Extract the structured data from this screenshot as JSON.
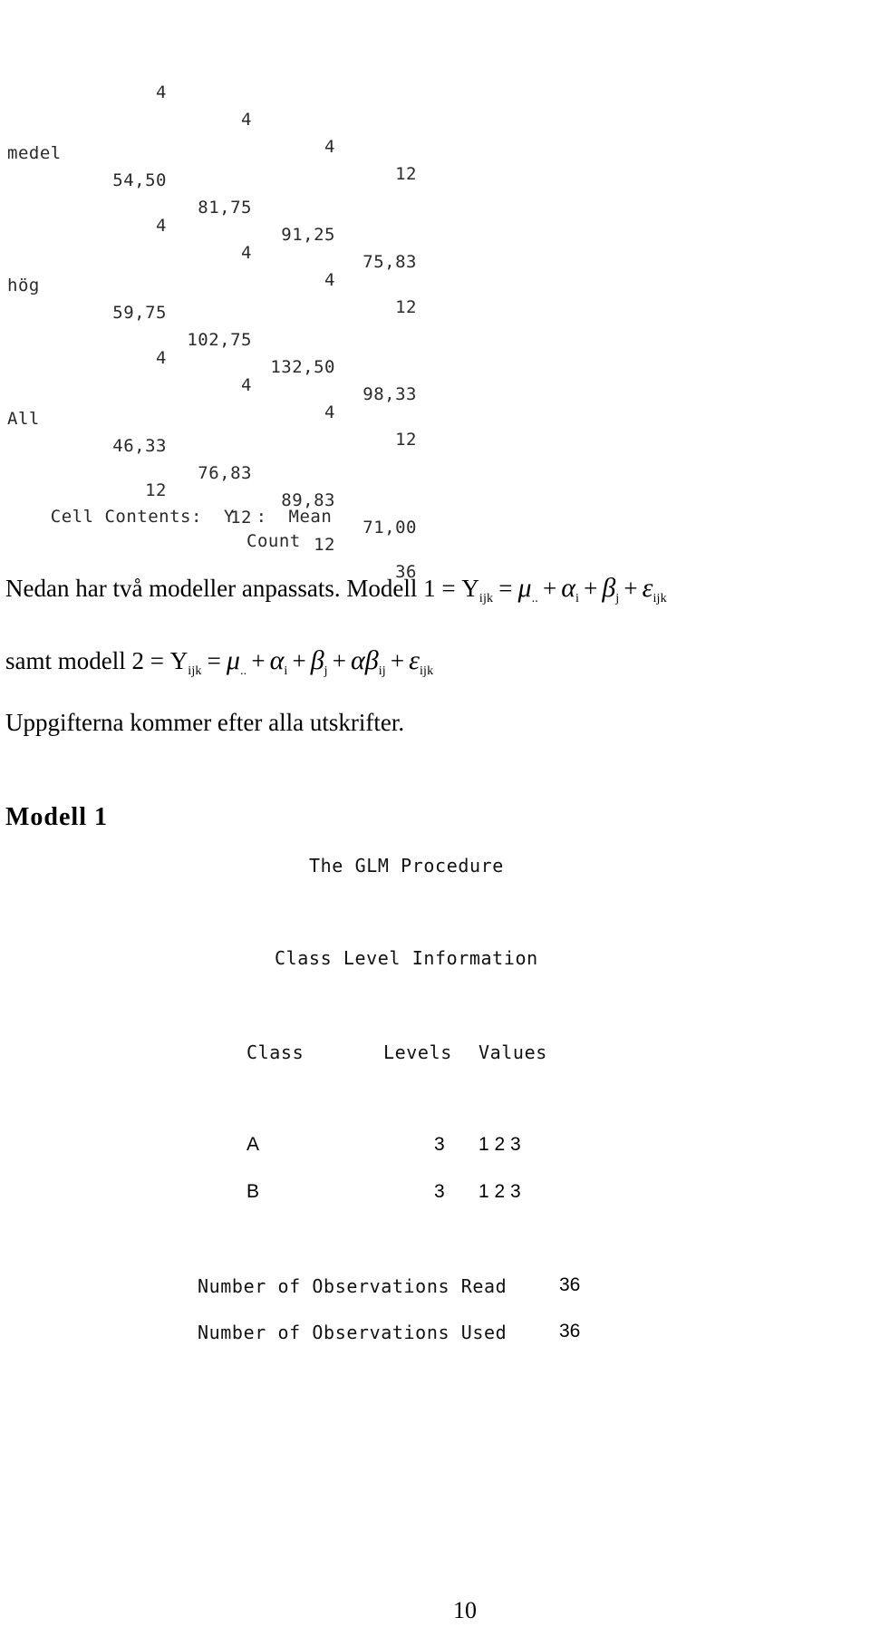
{
  "crosstab": {
    "rows": [
      {
        "label": "",
        "kind": "count",
        "cells": [
          "4",
          "4",
          "4",
          "12"
        ]
      },
      {
        "label": "medel",
        "kind": "mean",
        "cells": [
          "54,50",
          "81,75",
          "91,25",
          "75,83"
        ]
      },
      {
        "label": "",
        "kind": "count",
        "cells": [
          "4",
          "4",
          "4",
          "12"
        ]
      },
      {
        "label": "hög",
        "kind": "mean",
        "cells": [
          "59,75",
          "102,75",
          "132,50",
          "98,33"
        ]
      },
      {
        "label": "",
        "kind": "count",
        "cells": [
          "4",
          "4",
          "4",
          "12"
        ]
      },
      {
        "label": "All",
        "kind": "mean",
        "cells": [
          "46,33",
          "76,83",
          "89,83",
          "71,00"
        ]
      },
      {
        "label": "",
        "kind": "count",
        "cells": [
          "12",
          "12",
          "12",
          "36"
        ]
      }
    ],
    "cell_contents_label": "Cell Contents:",
    "cell_contents_var": "Y",
    "cell_contents_colon": ":",
    "cell_contents_stat1": "Mean",
    "cell_contents_stat2": "Count"
  },
  "body": {
    "intro_text": "Nedan har två modeller anpassats. Modell 1 = ",
    "model1": {
      "lhs": "Y",
      "lhs_sub": "ijk",
      "mu": "μ",
      "mu_sub": "..",
      "alpha": "α",
      "alpha_sub": "i",
      "beta": "β",
      "beta_sub": "j",
      "eps": "ε",
      "eps_sub": "ijk",
      "equals": "=",
      "plus": "+"
    },
    "model2_prefix": "samt modell 2 = ",
    "model2": {
      "lhs": "Y",
      "lhs_sub": "ijk",
      "mu": "μ",
      "mu_sub": "..",
      "alpha": "α",
      "alpha_sub": "i",
      "beta": "β",
      "beta_sub": "j",
      "alphabeta": "αβ",
      "alphabeta_sub": "ij",
      "eps": "ε",
      "eps_sub": "ijk",
      "equals": "=",
      "plus": "+"
    },
    "note": "Uppgifterna kommer efter alla utskrifter."
  },
  "section": {
    "heading": "Modell 1",
    "procedure_title": "The GLM Procedure",
    "class_level_title": "Class Level Information",
    "table": {
      "headers": [
        "Class",
        "Levels",
        "Values"
      ],
      "rows": [
        {
          "class": "A",
          "levels": "3",
          "values": "1 2 3"
        },
        {
          "class": "B",
          "levels": "3",
          "values": "1 2 3"
        }
      ]
    },
    "obs_read_label": "Number of Observations Read",
    "obs_read_value": "36",
    "obs_used_label": "Number of Observations Used",
    "obs_used_value": "36"
  },
  "footer": {
    "page_number": "10"
  }
}
